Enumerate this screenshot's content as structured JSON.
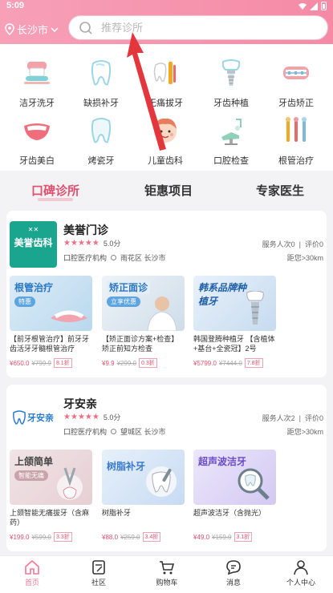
{
  "status": {
    "time": "5:09"
  },
  "location": {
    "city": "长沙市"
  },
  "search": {
    "placeholder": "推荐诊所"
  },
  "categories": [
    {
      "label": "洁牙洗牙",
      "icon": "teeth-cleaning-icon"
    },
    {
      "label": "缺损补牙",
      "icon": "tooth-repair-icon"
    },
    {
      "label": "无痛拔牙",
      "icon": "tooth-extraction-icon"
    },
    {
      "label": "牙齿种植",
      "icon": "dental-implant-icon"
    },
    {
      "label": "牙齿矫正",
      "icon": "braces-icon"
    },
    {
      "label": "牙齿美白",
      "icon": "whitening-smile-icon"
    },
    {
      "label": "烤瓷牙",
      "icon": "porcelain-tooth-icon"
    },
    {
      "label": "儿童齿科",
      "icon": "child-face-icon"
    },
    {
      "label": "口腔检查",
      "icon": "dental-chair-icon"
    },
    {
      "label": "根管治疗",
      "icon": "dental-tools-icon"
    }
  ],
  "tabs": [
    {
      "label": "口碑诊所"
    },
    {
      "label": "钜惠项目"
    },
    {
      "label": "专家医生"
    }
  ],
  "clinics": [
    {
      "name": "美誉门诊",
      "logo_text": "美誉齿科",
      "score": "5.0分",
      "type": "口腔医疗机构",
      "address": "雨花区 长沙市",
      "service": "服务人次0",
      "reviews": "评价0",
      "distance": "距您>30km",
      "products": [
        {
          "img_title": "根管治疗",
          "pill": "特惠",
          "title": "【前牙根管治疗】前牙牙齿活牙牙髓根管治疗",
          "price": "¥650.0",
          "old": "¥799.9",
          "discount": "8.1折"
        },
        {
          "img_title": "矫正面诊",
          "pill": "立享优惠",
          "title": "【矫正面诊方案+检查】矫正前知方检查",
          "price": "¥9.9",
          "old": "¥299.0",
          "discount": "0.3折"
        },
        {
          "img_title": "韩系品牌种植牙",
          "pill": "",
          "title": "韩国登腾种植牙 【含植体+基台+全瓷冠】2号",
          "price": "¥5799.0",
          "old": "¥7444.0",
          "discount": "7.8折"
        }
      ]
    },
    {
      "name": "牙安亲",
      "logo_text": "牙安亲",
      "score": "5.0分",
      "type": "口腔医疗机构",
      "address": "望城区 长沙市",
      "service": "服务人次2",
      "reviews": "评价0",
      "distance": "距您>30km",
      "products": [
        {
          "img_title": "上颌简单",
          "pill": "智能无痛",
          "title": "上颌智能无痛拔牙（含麻药）",
          "price": "¥199.0",
          "old": "¥599.0",
          "discount": "3.3折"
        },
        {
          "img_title": "树脂补牙",
          "pill": "",
          "title": "树脂补牙",
          "price": "¥88.0",
          "old": "¥259.0",
          "discount": "3.4折"
        },
        {
          "img_title": "超声波洁牙",
          "pill": "",
          "title": "超声波洁牙（含抛光）",
          "price": "¥49.0",
          "old": "¥159.0",
          "discount": "3.1折"
        }
      ]
    }
  ],
  "nav": [
    {
      "label": "首页"
    },
    {
      "label": "社区"
    },
    {
      "label": "购物车"
    },
    {
      "label": "消息"
    },
    {
      "label": "个人中心"
    }
  ],
  "colors": {
    "accent": "#f27a95",
    "header": "#f58aa6",
    "price": "#e0506e"
  }
}
